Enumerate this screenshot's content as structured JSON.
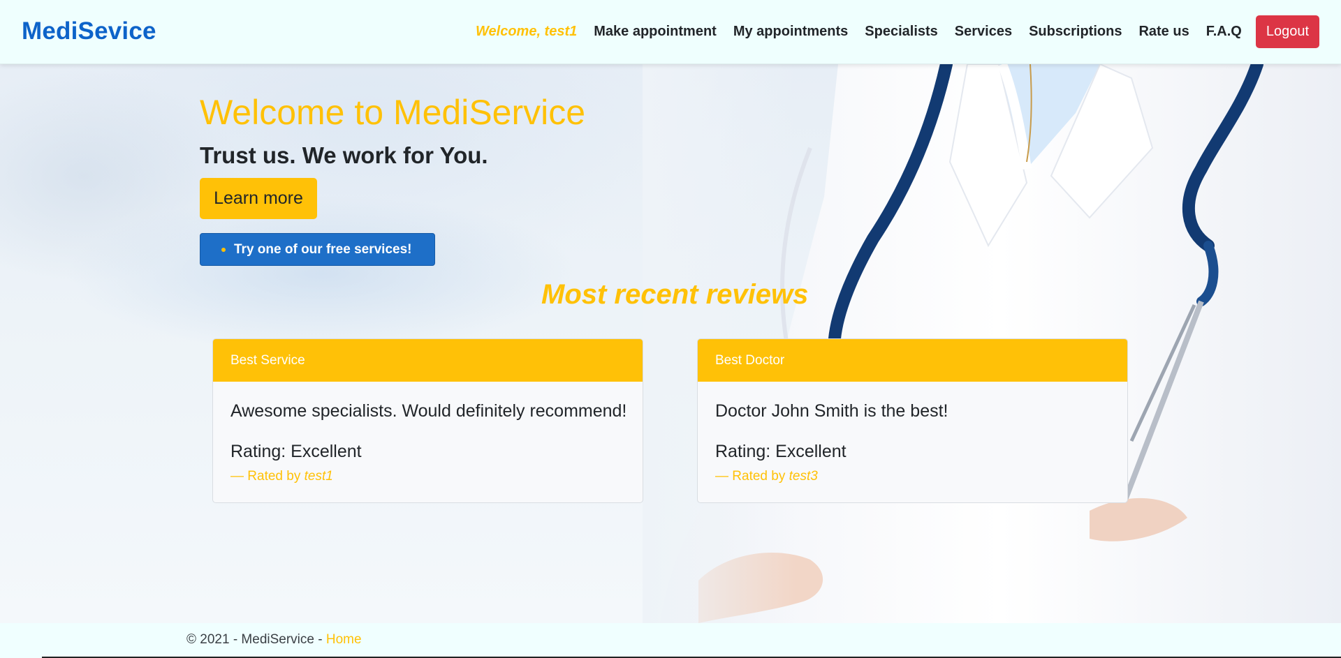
{
  "app": {
    "brand": "MediSevice"
  },
  "nav": {
    "welcome": "Welcome, test1",
    "links": [
      "Make appointment",
      "My appointments",
      "Specialists",
      "Services",
      "Subscriptions",
      "Rate us",
      "F.A.Q"
    ],
    "logout_label": "Logout",
    "logout_color": "#dc3545"
  },
  "hero": {
    "title": "Welcome to MediService",
    "subtitle": "Trust us. We work for You.",
    "learn_more_label": "Learn more",
    "free_services_label": "Try one of our free services!"
  },
  "reviews": {
    "heading": "Most recent reviews",
    "items": [
      {
        "header": "Best Service",
        "text": "Awesome specialists. Would definitely recommend!",
        "rating": "Rating: Excellent",
        "rated_by_prefix": "— Rated by ",
        "rated_by_user": "test1"
      },
      {
        "header": "Best Doctor",
        "text": "Doctor John Smith is the best!",
        "rating": "Rating: Excellent",
        "rated_by_prefix": "— Rated by ",
        "rated_by_user": "test3"
      }
    ]
  },
  "footer": {
    "copyright": "© 2021 - MediService - ",
    "home_link": "Home"
  },
  "colors": {
    "accent": "#ffc107",
    "brand": "#0d63c9",
    "primary_button": "#1e6fc8",
    "danger": "#dc3545"
  },
  "icons": {
    "hero_image": "doctor-with-stethoscope-image"
  }
}
